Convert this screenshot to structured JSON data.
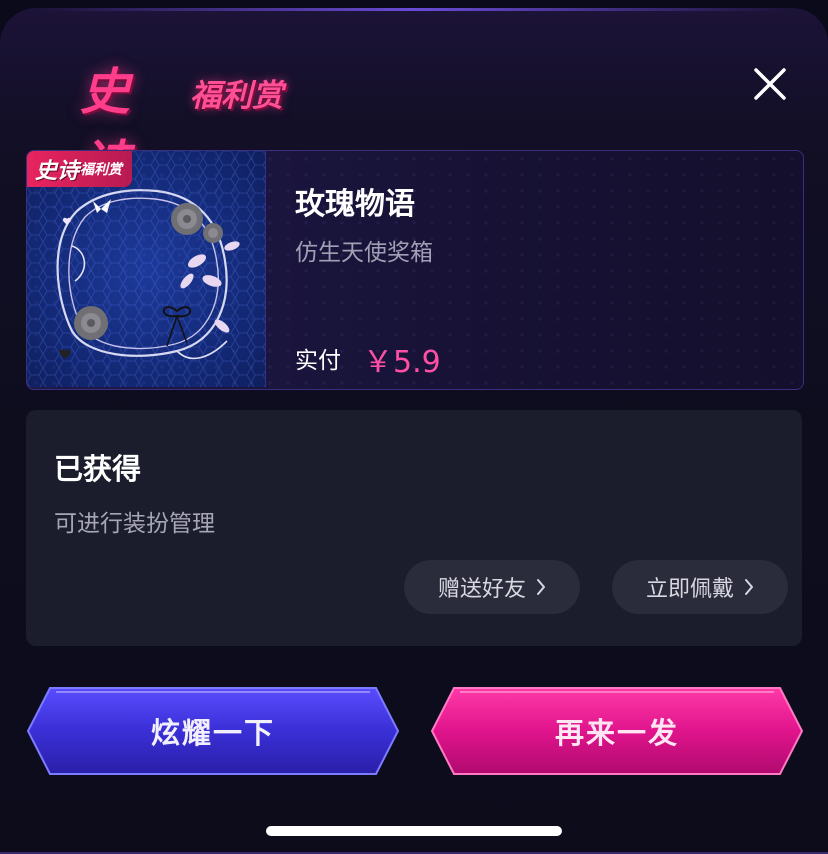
{
  "header": {
    "logo_main": "史诗",
    "logo_sub": "福利赏"
  },
  "product": {
    "badge_main": "史诗",
    "badge_sub": "福利赏",
    "title": "玫瑰物语",
    "subtitle": "仿生天使奖箱",
    "paid_label": "实付",
    "price": "￥5.9"
  },
  "status": {
    "title": "已获得",
    "subtitle": "可进行装扮管理",
    "gift_label": "赠送好友",
    "wear_label": "立即佩戴"
  },
  "actions": {
    "show_off_label": "炫耀一下",
    "again_label": "再来一发"
  },
  "colors": {
    "accent_pink": "#ff4fa4",
    "button_blue": "#3a2fd6",
    "button_pink": "#e0148c",
    "panel_bg": "#1b1c2c"
  }
}
